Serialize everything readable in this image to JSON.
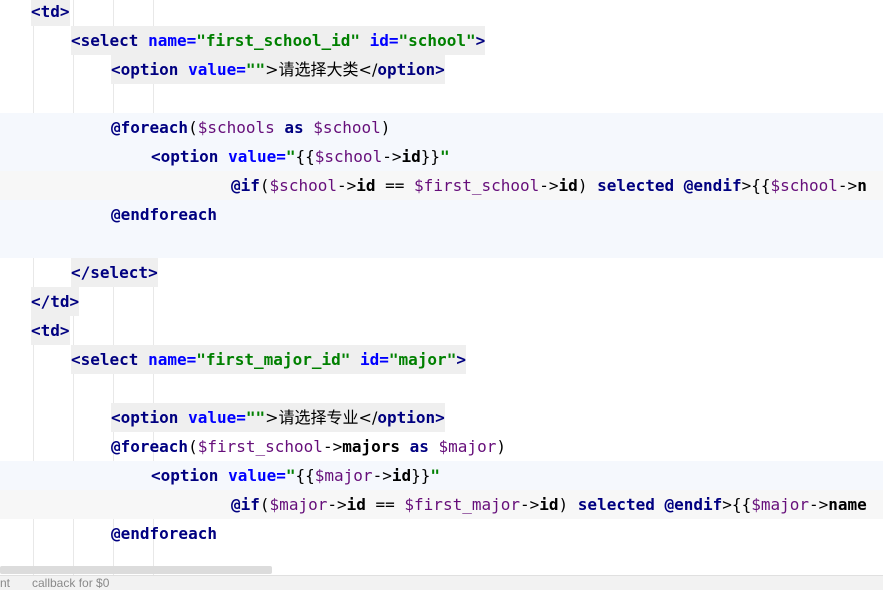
{
  "code": {
    "l1": "<td>",
    "l2_open": "<",
    "l2_tag": "select",
    "l2_attr1": " name=",
    "l2_val1": "\"first_school_id\"",
    "l2_attr2": " id=",
    "l2_val2": "\"school\"",
    "l2_close": ">",
    "l3_open": "<option ",
    "l3_attr": "value=",
    "l3_val": "\"\"",
    "l3_text": ">请选择大类</",
    "l3_tag_close": "option>",
    "l5_dir": "@foreach",
    "l5_a": "(",
    "l5_var1": "$schools",
    "l5_as": " as ",
    "l5_var2": "$school",
    "l5_b": ")",
    "l6_open": "<option ",
    "l6_attr": "value=",
    "l6_q": "\"",
    "l6_br": "{{",
    "l6_var": "$school",
    "l6_arrow": "->",
    "l6_prop": "id",
    "l6_br2": "}}",
    "l6_q2": "\"",
    "l7_dir": "@if",
    "l7_a": "(",
    "l7_var1": "$school",
    "l7_arrow1": "->",
    "l7_prop1": "id",
    "l7_eq": " == ",
    "l7_var2": "$first_school",
    "l7_arrow2": "->",
    "l7_prop2": "id",
    "l7_b": ") ",
    "l7_selected": "selected",
    "l7_sp": " ",
    "l7_endif": "@endif",
    "l7_rest_a": ">{{",
    "l7_rest_var": "$school",
    "l7_rest_arrow": "->",
    "l7_rest_tail": "n",
    "l8_dir": "@endforeach",
    "l10": "</select>",
    "l11": "</td>",
    "l12": "<td>",
    "l13_open": "<",
    "l13_tag": "select",
    "l13_attr1": " name=",
    "l13_val1": "\"first_major_id\"",
    "l13_attr2": " id=",
    "l13_val2": "\"major\"",
    "l13_close": ">",
    "l15_open": "<option ",
    "l15_attr": "value=",
    "l15_val": "\"\"",
    "l15_text": ">请选择专业</",
    "l15_tag_close": "option>",
    "l16_dir": "@foreach",
    "l16_a": "(",
    "l16_var1": "$first_school",
    "l16_arrow": "->",
    "l16_prop": "majors",
    "l16_as": " as ",
    "l16_var2": "$major",
    "l16_b": ")",
    "l17_open": "<option ",
    "l17_attr": "value=",
    "l17_q": "\"",
    "l17_br": "{{",
    "l17_var": "$major",
    "l17_arrow": "->",
    "l17_prop": "id",
    "l17_br2": "}}",
    "l17_q2": "\"",
    "l18_dir": "@if",
    "l18_a": "(",
    "l18_var1": "$major",
    "l18_arrow1": "->",
    "l18_prop1": "id",
    "l18_eq": " == ",
    "l18_var2": "$first_major",
    "l18_arrow2": "->",
    "l18_prop2": "id",
    "l18_b": ") ",
    "l18_selected": "selected",
    "l18_sp": " ",
    "l18_endif": "@endif",
    "l18_rest_a": ">{{",
    "l18_rest_var": "$major",
    "l18_rest_arrow": "->",
    "l18_rest_tail": "name",
    "l19_dir": "@endforeach"
  },
  "statusbar": {
    "left": "nt",
    "crumb": "callback for $0"
  }
}
